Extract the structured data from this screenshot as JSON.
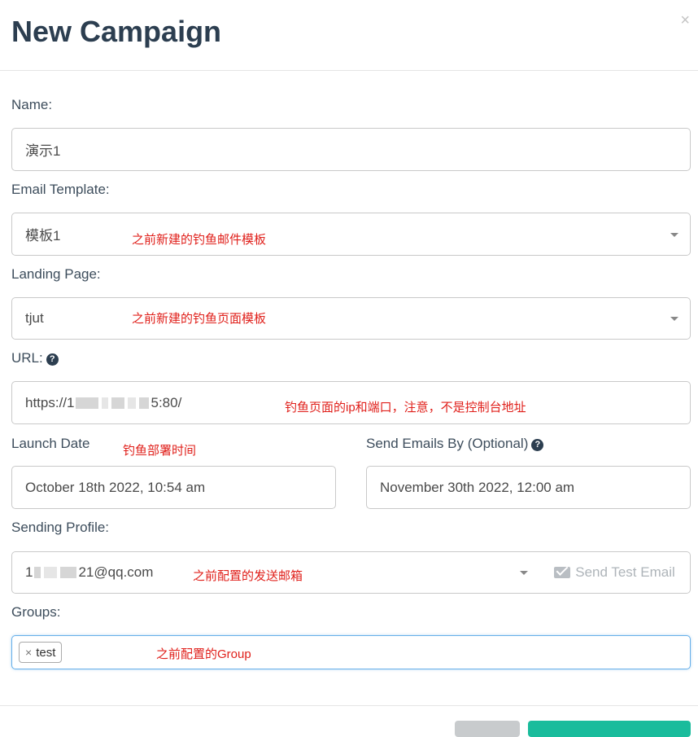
{
  "modal": {
    "title": "New Campaign",
    "close_symbol": "×"
  },
  "name": {
    "label": "Name:",
    "value": "演示1"
  },
  "email_template": {
    "label": "Email Template:",
    "value": "模板1",
    "note": "之前新建的钓鱼邮件模板"
  },
  "landing_page": {
    "label": "Landing Page:",
    "value": "tjut",
    "note": "之前新建的钓鱼页面模板"
  },
  "url": {
    "label": "URL:",
    "value_prefix": "https://1",
    "value_suffix": "5:80/",
    "note": "钓鱼页面的ip和端口，注意，不是控制台地址"
  },
  "launch_date": {
    "label": "Launch Date",
    "value": "October 18th 2022, 10:54 am",
    "note": "钓鱼部署时间"
  },
  "send_by": {
    "label": "Send Emails By (Optional)",
    "value": "November 30th 2022, 12:00 am"
  },
  "sending_profile": {
    "label": "Sending Profile:",
    "value_prefix": "1",
    "value_suffix": "21@qq.com",
    "note": "之前配置的发送邮箱",
    "send_test_label": "Send Test Email"
  },
  "groups": {
    "label": "Groups:",
    "tags": [
      {
        "label": "test"
      }
    ],
    "note": "之前配置的Group"
  },
  "colors": {
    "primary": "#1abc9c",
    "annotation": "#e0201b",
    "title": "#2c3e50"
  }
}
